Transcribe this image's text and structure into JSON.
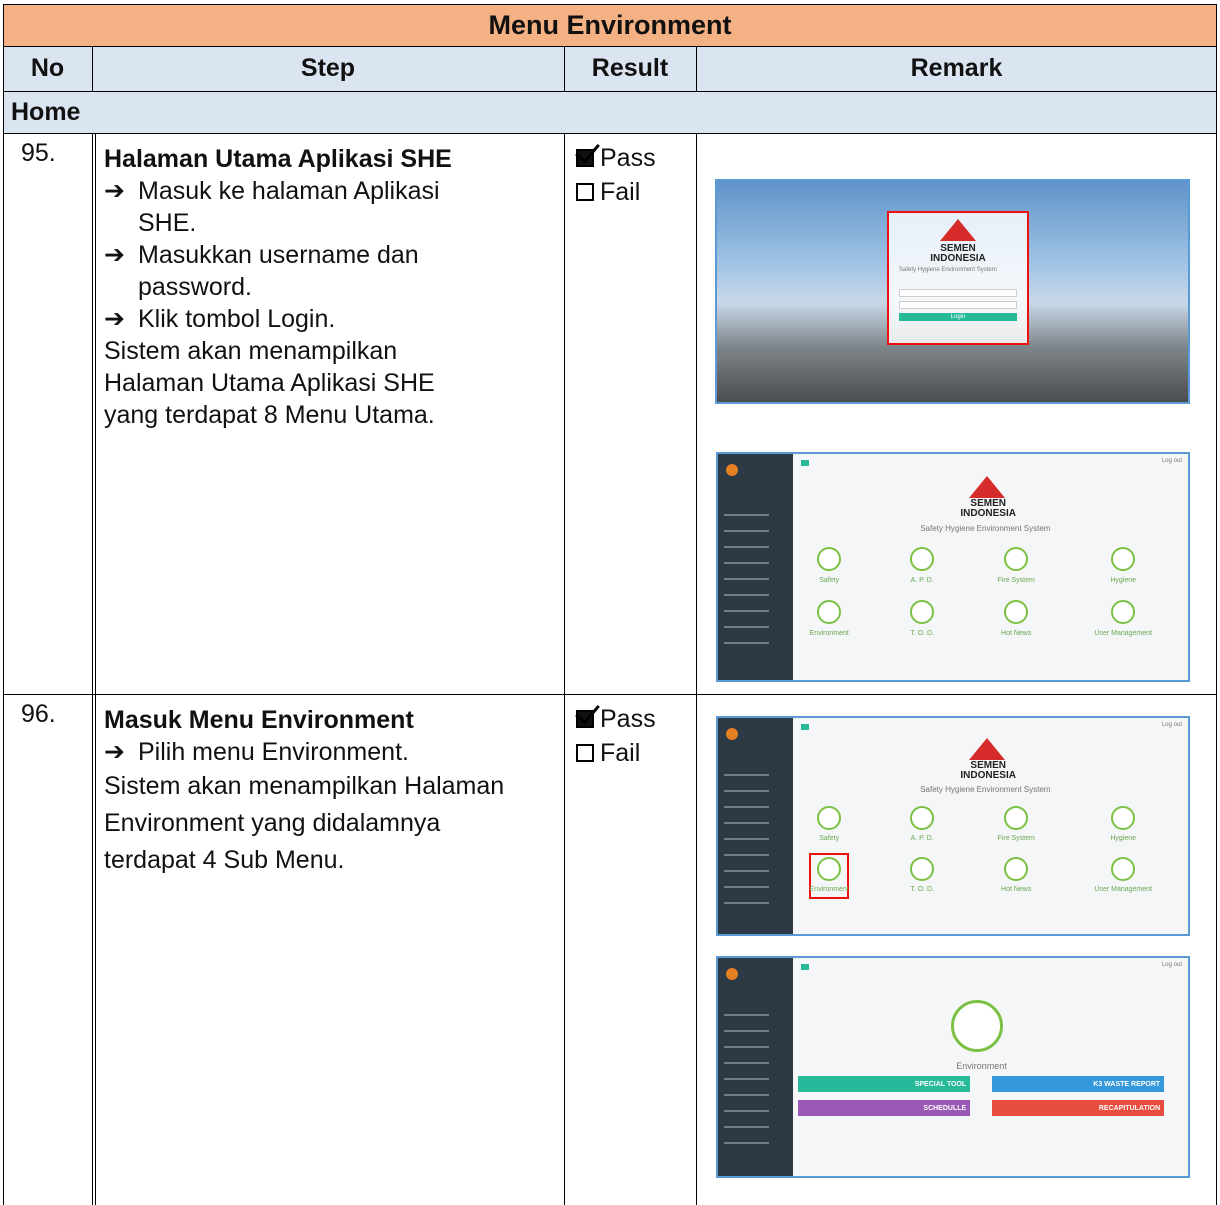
{
  "title": "Menu Environment",
  "headers": {
    "no": "No",
    "step": "Step",
    "result": "Result",
    "remark": "Remark"
  },
  "section": "Home",
  "rows": [
    {
      "no": "95.",
      "title": "Halaman Utama Aplikasi SHE",
      "arrows": [
        "Masuk ke halaman Aplikasi SHE.",
        "Masukkan username dan password.",
        "Klik tombol Login."
      ],
      "desc": "Sistem akan menampilkan Halaman Utama Aplikasi SHE yang terdapat 8 Menu Utama.",
      "pass": "Pass",
      "fail": "Fail"
    },
    {
      "no": "96.",
      "title": "Masuk Menu Environment",
      "arrows": [
        "Pilih menu Environment."
      ],
      "desc": "Sistem akan menampilkan Halaman Environment yang didalamnya terdapat 4 Sub Menu.",
      "pass": "Pass",
      "fail": "Fail"
    }
  ],
  "arrow_glyph": "➔",
  "screens": {
    "logo_top": "SEMEN",
    "logo_bottom": "INDONESIA",
    "system_name": "Safety Hygiene Environment System",
    "login_button": "Login",
    "logout": "Log out",
    "menus": [
      "Safety",
      "A. P. D.",
      "Fire System",
      "Hygiene",
      "Environment",
      "T. O. D.",
      "Hot News",
      "User Management"
    ],
    "env_title": "Environment",
    "env_buttons": [
      "SPECIAL TOOL",
      "K3 WASTE REPORT",
      "SCHEDULLE",
      "RECAPITULATION"
    ],
    "env_button_colors": [
      "#26b99a",
      "#3498db",
      "#9b59b6",
      "#e74c3c"
    ]
  }
}
